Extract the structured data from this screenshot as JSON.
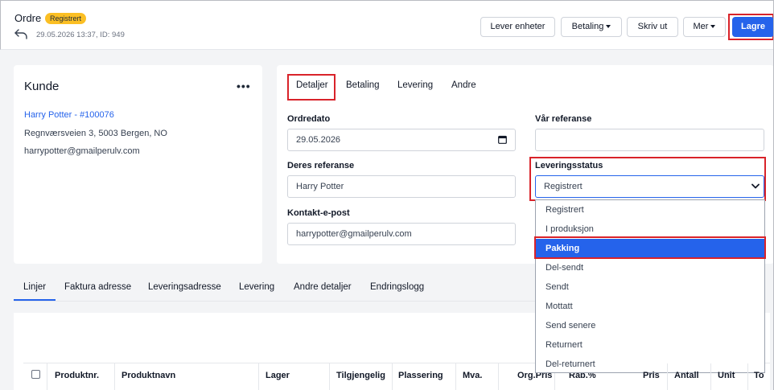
{
  "header": {
    "title": "Ordre",
    "status_badge": "Registrert",
    "meta": "29.05.2026 13:37, ID: 949",
    "buttons": {
      "deliver_units": "Lever enheter",
      "payment": "Betaling",
      "print": "Skriv ut",
      "more": "Mer",
      "save": "Lagre"
    }
  },
  "customer": {
    "title": "Kunde",
    "menu": "•••",
    "name_link": "Harry Potter - #100076",
    "address": "Regnværsveien 3, 5003 Bergen, NO",
    "email": "harrypotter@gmailperulv.com"
  },
  "details": {
    "tabs": [
      "Detaljer",
      "Betaling",
      "Levering",
      "Andre"
    ],
    "order_date_label": "Ordredato",
    "order_date_value": "29.05.2026",
    "our_ref_label": "Vår referanse",
    "our_ref_value": "",
    "their_ref_label": "Deres referanse",
    "their_ref_value": "Harry Potter",
    "delivery_status_label": "Leveringsstatus",
    "delivery_status_value": "Registrert",
    "contact_email_label": "Kontakt-e-post",
    "contact_email_value": "harrypotter@gmailperulv.com",
    "status_options": [
      "Registrert",
      "I produksjon",
      "Pakking",
      "Del-sendt",
      "Sendt",
      "Mottatt",
      "Send senere",
      "Returnert",
      "Del-returnert"
    ],
    "highlighted_option": "Pakking"
  },
  "bottom_tabs": [
    "Linjer",
    "Faktura adresse",
    "Leveringsadresse",
    "Levering",
    "Andre detaljer",
    "Endringslogg"
  ],
  "table": {
    "columns": [
      "Produktnr.",
      "Produktnavn",
      "Lager",
      "Tilgjengelig",
      "Plassering",
      "Mva.",
      "Org.Pris",
      "Rab.%",
      "Pris",
      "Antall",
      "Unit",
      "To"
    ]
  },
  "colors": {
    "accent": "#2563eb",
    "highlight_border": "#d9232a",
    "badge": "#fbbf24"
  }
}
